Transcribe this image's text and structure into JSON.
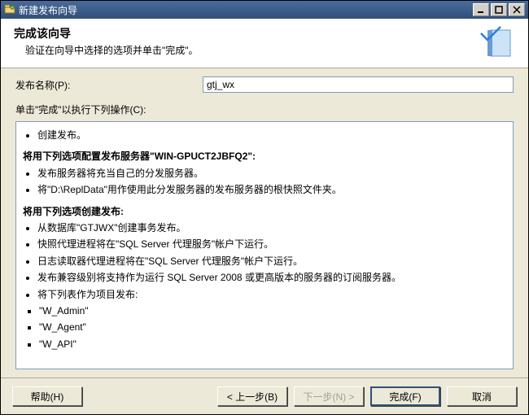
{
  "window": {
    "title": "新建发布向导"
  },
  "header": {
    "title": "完成该向导",
    "subtitle": "验证在向导中选择的选项并单击\"完成\"。"
  },
  "form": {
    "publish_name_label": "发布名称(P):",
    "publish_name_value": "gtj_wx",
    "instruction": "单击\"完成\"以执行下列操作(C):"
  },
  "details": {
    "items": [
      "创建发布。"
    ],
    "config_heading": "将用下列选项配置发布服务器\"WIN-GPUCT2JBFQ2\":",
    "config_items": [
      "发布服务器将充当自己的分发服务器。",
      "将\"D:\\ReplData\"用作使用此分发服务器的发布服务器的根快照文件夹。"
    ],
    "create_heading": "将用下列选项创建发布:",
    "create_items": [
      "从数据库\"GTJWX\"创建事务发布。",
      "快照代理进程将在\"SQL Server 代理服务\"帐户下运行。",
      "日志读取器代理进程将在\"SQL Server 代理服务\"帐户下运行。",
      "发布兼容级别将支持作为运行 SQL Server 2008 或更高版本的服务器的订阅服务器。",
      "将下列表作为项目发布:"
    ],
    "tables": [
      "\"W_Admin\"",
      "\"W_Agent\"",
      "\"W_API\""
    ]
  },
  "buttons": {
    "help": "帮助(H)",
    "back": "< 上一步(B)",
    "next": "下一步(N) >",
    "finish": "完成(F)",
    "cancel": "取消"
  }
}
